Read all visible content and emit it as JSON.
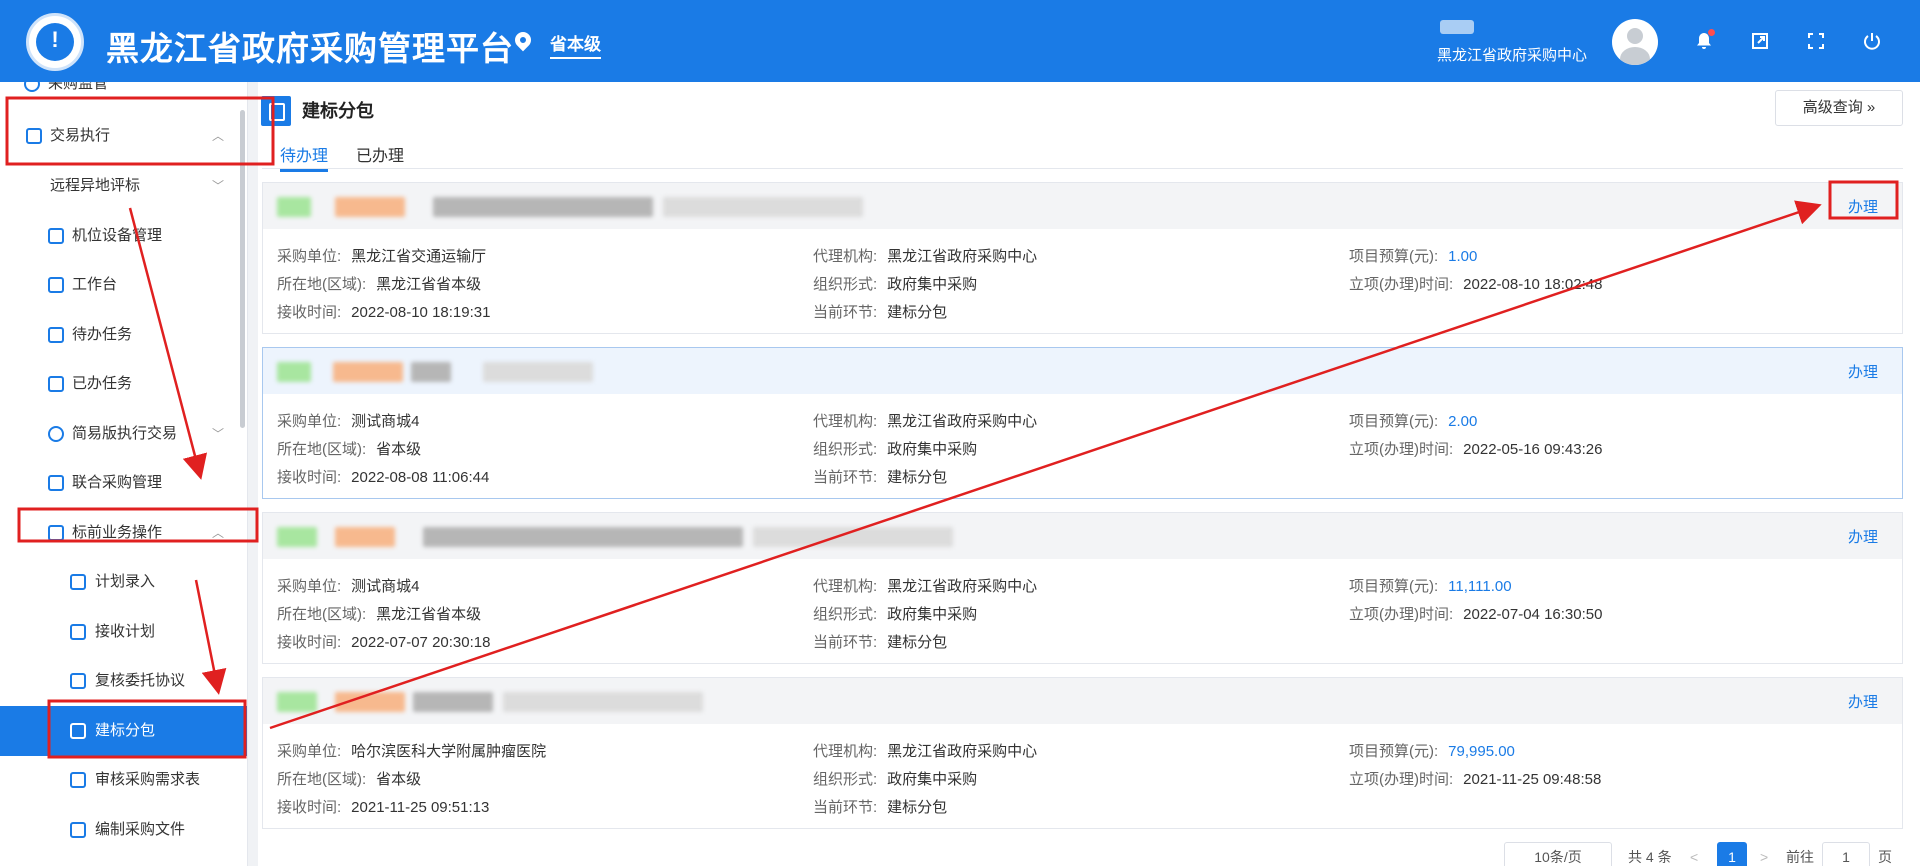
{
  "app": {
    "title": "黑龙江省政府采购管理平台",
    "location": "省本级",
    "user_org": "黑龙江省政府采购中心"
  },
  "colors": {
    "primary": "#1a7be6",
    "annotation": "#e02020"
  },
  "sidebar": {
    "items": [
      {
        "label": "采购监管",
        "icon": "check-circle-icon"
      },
      {
        "label": "交易执行",
        "icon": "clipboard-icon"
      },
      {
        "label": "远程异地评标",
        "icon": ""
      },
      {
        "label": "机位设备管理",
        "icon": "device-icon"
      },
      {
        "label": "工作台",
        "icon": "workbench-icon"
      },
      {
        "label": "待办任务",
        "icon": "todo-icon"
      },
      {
        "label": "已办任务",
        "icon": "done-icon"
      },
      {
        "label": "简易版执行交易",
        "icon": "simple-icon"
      },
      {
        "label": "联合采购管理",
        "icon": "joint-icon"
      },
      {
        "label": "标前业务操作",
        "icon": "cart-icon"
      },
      {
        "label": "计划录入",
        "icon": "plan-icon"
      },
      {
        "label": "接收计划",
        "icon": "receive-icon"
      },
      {
        "label": "复核委托协议",
        "icon": "review-icon"
      },
      {
        "label": "建标分包",
        "icon": "package-icon"
      },
      {
        "label": "审核采购需求表",
        "icon": "audit-icon"
      },
      {
        "label": "编制采购文件",
        "icon": "file-icon"
      }
    ]
  },
  "main": {
    "title": "建标分包",
    "advanced_search": "高级查询",
    "tabs": [
      "待办理",
      "已办理"
    ],
    "field_labels": {
      "purchaser": "采购单位:",
      "agency": "代理机构:",
      "budget": "项目预算(元):",
      "region": "所在地(区域):",
      "form": "组织形式:",
      "approval_time": "立项(办理)时间:",
      "receive_time": "接收时间:",
      "stage": "当前环节:"
    },
    "action_label": "办理",
    "cards": [
      {
        "purchaser": "黑龙江省交通运输厅",
        "agency": "黑龙江省政府采购中心",
        "budget": "1.00",
        "region": "黑龙江省省本级",
        "form": "政府集中采购",
        "approval_time": "2022-08-10 18:02:48",
        "receive_time": "2022-08-10 18:19:31",
        "stage": "建标分包"
      },
      {
        "purchaser": "测试商城4",
        "agency": "黑龙江省政府采购中心",
        "budget": "2.00",
        "region": "省本级",
        "form": "政府集中采购",
        "approval_time": "2022-05-16 09:43:26",
        "receive_time": "2022-08-08 11:06:44",
        "stage": "建标分包"
      },
      {
        "purchaser": "测试商城4",
        "agency": "黑龙江省政府采购中心",
        "budget": "11,111.00",
        "region": "黑龙江省省本级",
        "form": "政府集中采购",
        "approval_time": "2022-07-04 16:30:50",
        "receive_time": "2022-07-07 20:30:18",
        "stage": "建标分包"
      },
      {
        "purchaser": "哈尔滨医科大学附属肿瘤医院",
        "agency": "黑龙江省政府采购中心",
        "budget": "79,995.00",
        "region": "省本级",
        "form": "政府集中采购",
        "approval_time": "2021-11-25 09:48:58",
        "receive_time": "2021-11-25 09:51:13",
        "stage": "建标分包"
      }
    ]
  },
  "pagination": {
    "page_size": "10条/页",
    "total": "共 4 条",
    "current_page": "1",
    "goto_label": "前往",
    "goto_value": "1",
    "page_unit": "页"
  }
}
